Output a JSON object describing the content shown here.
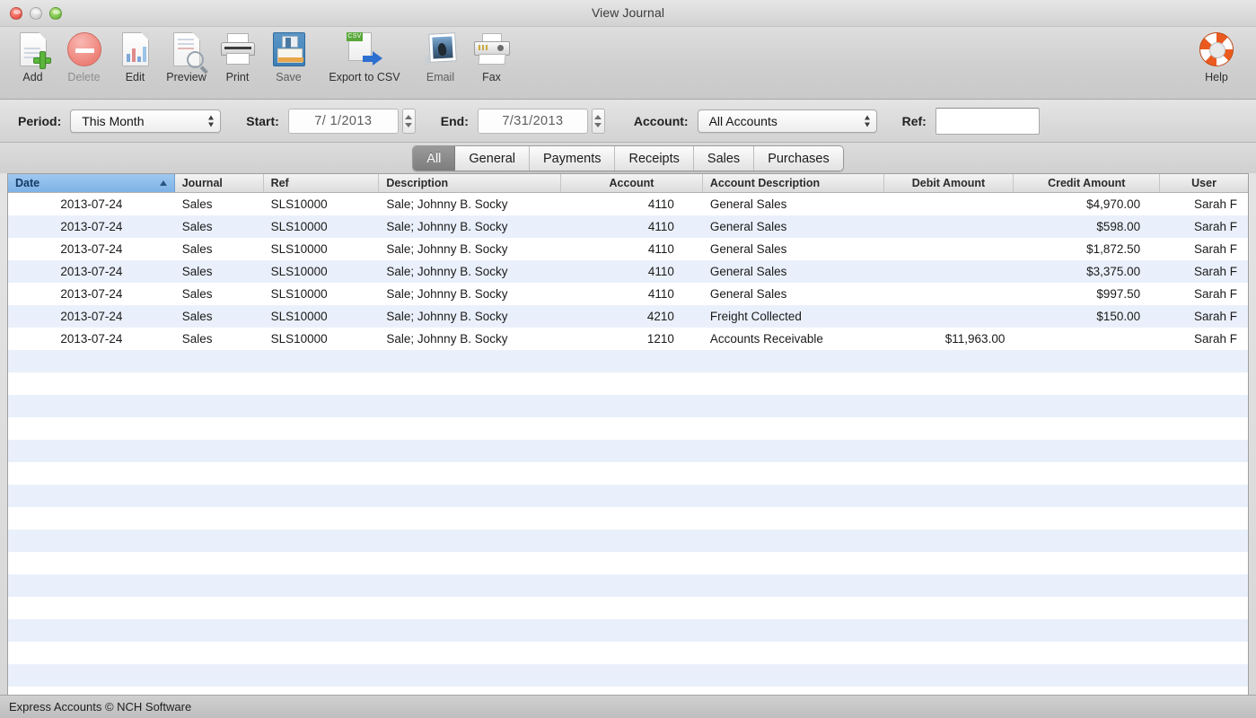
{
  "window": {
    "title": "View Journal",
    "traffic_lights": [
      "close",
      "minimize",
      "zoom"
    ]
  },
  "toolbar": {
    "buttons": [
      {
        "label": "Add",
        "icon": "document-add-icon",
        "enabled": true
      },
      {
        "label": "Delete",
        "icon": "minus-circle-icon",
        "enabled": false
      },
      {
        "label": "Edit",
        "icon": "document-edit-icon",
        "enabled": true
      },
      {
        "label": "Preview",
        "icon": "document-preview-icon",
        "enabled": true
      },
      {
        "label": "Print",
        "icon": "printer-icon",
        "enabled": true
      },
      {
        "label": "Save",
        "icon": "floppy-disk-icon",
        "enabled": true
      },
      {
        "label": "Export to CSV",
        "icon": "csv-export-icon",
        "enabled": true
      },
      {
        "label": "Email",
        "icon": "email-photo-icon",
        "enabled": true
      },
      {
        "label": "Fax",
        "icon": "fax-machine-icon",
        "enabled": true
      }
    ],
    "help": {
      "label": "Help",
      "icon": "life-ring-icon"
    }
  },
  "filters": {
    "period_label": "Period:",
    "period_value": "This Month",
    "start_label": "Start:",
    "start_value": "7/ 1/2013",
    "end_label": "End:",
    "end_value": "7/31/2013",
    "account_label": "Account:",
    "account_value": "All Accounts",
    "ref_label": "Ref:",
    "ref_value": "",
    "ref_placeholder": ""
  },
  "tabs": {
    "active": "All",
    "items": [
      {
        "label": "All"
      },
      {
        "label": "General"
      },
      {
        "label": "Payments"
      },
      {
        "label": "Receipts"
      },
      {
        "label": "Sales"
      },
      {
        "label": "Purchases"
      }
    ]
  },
  "table": {
    "sort_column": "Date",
    "sort_direction": "ascending",
    "columns": [
      {
        "key": "date",
        "label": "Date"
      },
      {
        "key": "journal",
        "label": "Journal"
      },
      {
        "key": "ref",
        "label": "Ref"
      },
      {
        "key": "description",
        "label": "Description"
      },
      {
        "key": "account",
        "label": "Account"
      },
      {
        "key": "account_description",
        "label": "Account Description"
      },
      {
        "key": "debit",
        "label": "Debit Amount"
      },
      {
        "key": "credit",
        "label": "Credit Amount"
      },
      {
        "key": "user",
        "label": "User"
      }
    ],
    "rows": [
      {
        "date": "2013-07-24",
        "journal": "Sales",
        "ref": "SLS10000",
        "description": "Sale; Johnny B. Socky",
        "account": "4110",
        "account_description": "General Sales",
        "debit": "",
        "credit": "$4,970.00",
        "user": "Sarah F"
      },
      {
        "date": "2013-07-24",
        "journal": "Sales",
        "ref": "SLS10000",
        "description": "Sale; Johnny B. Socky",
        "account": "4110",
        "account_description": "General Sales",
        "debit": "",
        "credit": "$598.00",
        "user": "Sarah F"
      },
      {
        "date": "2013-07-24",
        "journal": "Sales",
        "ref": "SLS10000",
        "description": "Sale; Johnny B. Socky",
        "account": "4110",
        "account_description": "General Sales",
        "debit": "",
        "credit": "$1,872.50",
        "user": "Sarah F"
      },
      {
        "date": "2013-07-24",
        "journal": "Sales",
        "ref": "SLS10000",
        "description": "Sale; Johnny B. Socky",
        "account": "4110",
        "account_description": "General Sales",
        "debit": "",
        "credit": "$3,375.00",
        "user": "Sarah F"
      },
      {
        "date": "2013-07-24",
        "journal": "Sales",
        "ref": "SLS10000",
        "description": "Sale; Johnny B. Socky",
        "account": "4110",
        "account_description": "General Sales",
        "debit": "",
        "credit": "$997.50",
        "user": "Sarah F"
      },
      {
        "date": "2013-07-24",
        "journal": "Sales",
        "ref": "SLS10000",
        "description": "Sale; Johnny B. Socky",
        "account": "4210",
        "account_description": "Freight Collected",
        "debit": "",
        "credit": "$150.00",
        "user": "Sarah F"
      },
      {
        "date": "2013-07-24",
        "journal": "Sales",
        "ref": "SLS10000",
        "description": "Sale; Johnny B. Socky",
        "account": "1210",
        "account_description": "Accounts Receivable",
        "debit": "$11,963.00",
        "credit": "",
        "user": "Sarah F"
      }
    ],
    "empty_row_count": 16
  },
  "statusbar": {
    "text": "Express Accounts © NCH Software"
  },
  "colors": {
    "sort_header": "#7fb2e6",
    "alt_row": "#eaf0fb",
    "active_tab": "#7d7d7d",
    "help_accent": "#ea5a1f"
  }
}
